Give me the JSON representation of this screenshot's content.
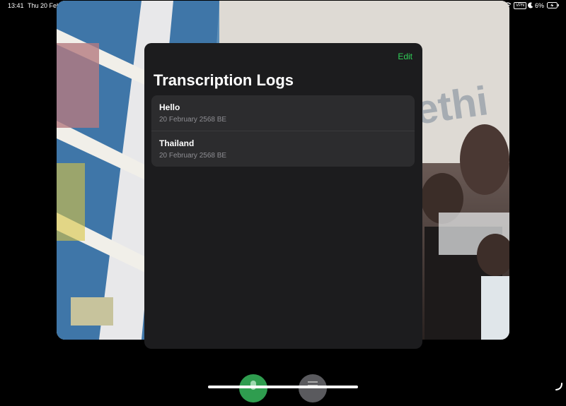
{
  "status_bar": {
    "time": "13:41",
    "date": "Thu 20 Feb",
    "vpn": "VPN",
    "battery": "6%"
  },
  "panel": {
    "edit_label": "Edit",
    "title": "Transcription Logs",
    "logs": [
      {
        "title": "Hello",
        "date": "20 February 2568 BE"
      },
      {
        "title": "Thailand",
        "date": "20 February 2568 BE"
      }
    ]
  },
  "colors": {
    "accent": "#30d158",
    "panel_bg": "#1c1c1e",
    "row_bg": "#2c2c2e",
    "swift_orange": "#f06a2a"
  }
}
